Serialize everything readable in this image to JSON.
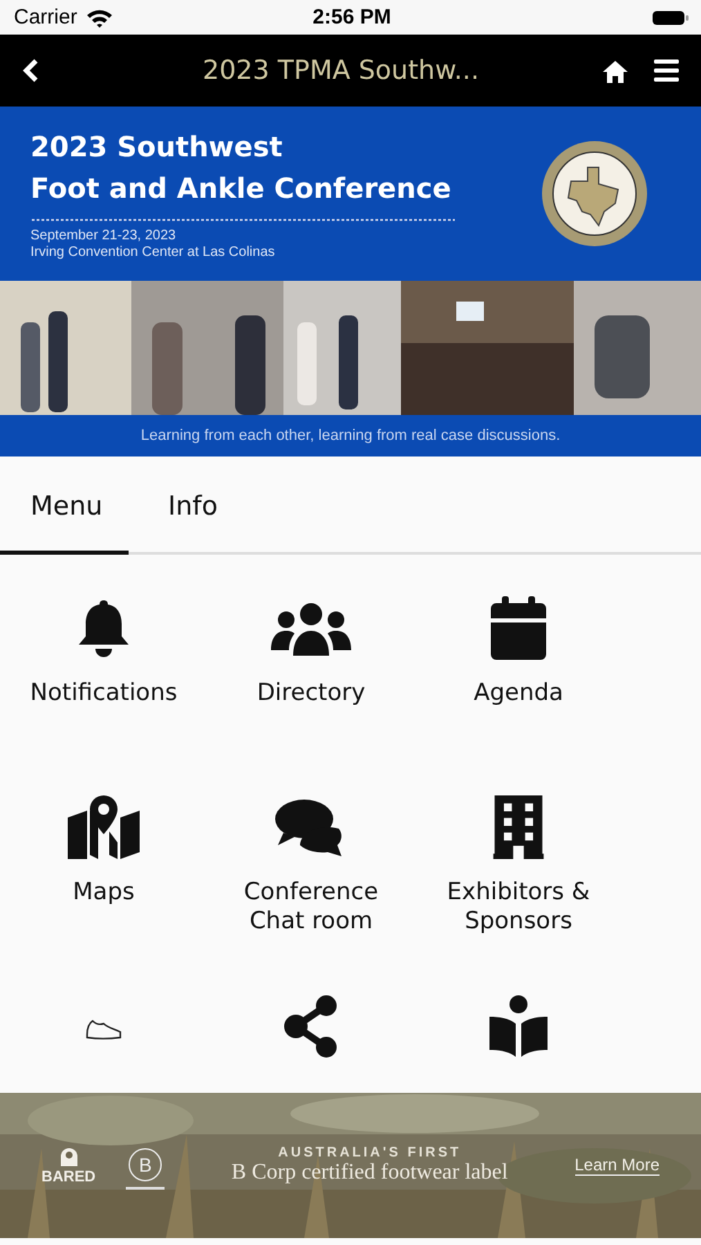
{
  "status_bar": {
    "carrier": "Carrier",
    "time": "2:56 PM"
  },
  "nav_bar": {
    "title": "2023 TPMA Southw..."
  },
  "banner": {
    "title_line_1": "2023 Southwest",
    "title_line_2": "Foot and Ankle Conference",
    "dates": "September 21-23, 2023",
    "venue": "Irving Convention Center at Las Colinas",
    "tagline": "Learning from each other, learning from real case discussions."
  },
  "tabs": [
    {
      "label": "Menu",
      "selected": true
    },
    {
      "label": "Info",
      "selected": false
    }
  ],
  "tiles": [
    {
      "kind": "labeled",
      "label": "Notifications"
    },
    {
      "kind": "labeled",
      "label": "Directory"
    },
    {
      "kind": "labeled",
      "label": "Agenda"
    },
    {
      "kind": "labeled",
      "label": "Maps"
    },
    {
      "kind": "labeled",
      "label": "Conference Chat room"
    },
    {
      "kind": "labeled",
      "label": "Exhibitors & Sponsors"
    },
    {
      "kind": "icon-only"
    },
    {
      "kind": "icon-only"
    },
    {
      "kind": "icon-only"
    }
  ],
  "ad": {
    "brand": "BARED",
    "badge": "B",
    "kicker": "AUSTRALIA'S FIRST",
    "headline": "B Corp certified footwear label",
    "link": "Learn More"
  }
}
